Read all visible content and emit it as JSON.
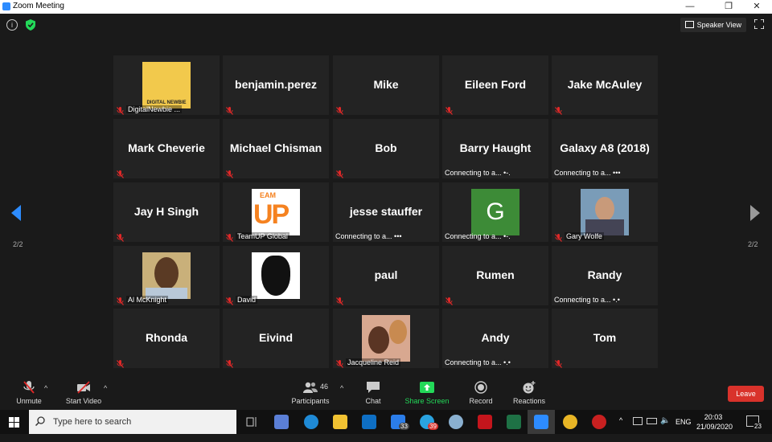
{
  "window": {
    "title": "Zoom Meeting",
    "minimize": "—",
    "restore": "❐",
    "close": "✕"
  },
  "top": {
    "speaker_view": "Speaker View"
  },
  "tiles": [
    {
      "name": "",
      "label": "DigitalNewbie ..."
    },
    {
      "name": "benjamin.perez",
      "label": ""
    },
    {
      "name": "Mike",
      "label": ""
    },
    {
      "name": "Eileen Ford",
      "label": ""
    },
    {
      "name": "Jake McAuley",
      "label": ""
    },
    {
      "name": "Mark Cheverie",
      "label": ""
    },
    {
      "name": "Michael Chisman",
      "label": ""
    },
    {
      "name": "Bob",
      "label": ""
    },
    {
      "name": "Barry Haught",
      "conn": "Connecting to a... •-."
    },
    {
      "name": "Galaxy A8 (2018)",
      "conn": "Connecting to a... •••"
    },
    {
      "name": "Jay H Singh",
      "label": ""
    },
    {
      "name": "",
      "label": "TeamUP Global"
    },
    {
      "name": "jesse stauffer",
      "conn": "Connecting to a... •••"
    },
    {
      "name": "",
      "conn": "Connecting to a... •-."
    },
    {
      "name": "",
      "label": "Gary Wolfe"
    },
    {
      "name": "",
      "label": "Al McKnight"
    },
    {
      "name": "",
      "label": "David"
    },
    {
      "name": "paul",
      "label": ""
    },
    {
      "name": "Rumen",
      "label": ""
    },
    {
      "name": "Randy",
      "conn": "Connecting to a... •.•"
    },
    {
      "name": "Rhonda",
      "label": ""
    },
    {
      "name": "Eivind",
      "label": ""
    },
    {
      "name": "",
      "label": "Jacqueline Reid"
    },
    {
      "name": "Andy",
      "conn": "Connecting to a... •.•"
    },
    {
      "name": "Tom",
      "label": ""
    }
  ],
  "pics": {
    "g_letter": "G",
    "teamup_top": "EAM",
    "teamup_big": "UP",
    "newbie_text": "DIGITAL NEWBIE"
  },
  "paging": {
    "left": "2/2",
    "right": "2/2"
  },
  "toolbar": {
    "unmute": "Unmute",
    "start_video": "Start Video",
    "participants": "Participants",
    "participants_count": "46",
    "chat": "Chat",
    "share_screen": "Share Screen",
    "record": "Record",
    "reactions": "Reactions",
    "leave": "Leave"
  },
  "taskbar": {
    "search_placeholder": "Type here to search",
    "badge_mail": "33",
    "badge_telegram": "39",
    "language": "ENG",
    "time": "20:03",
    "date": "21/09/2020",
    "notifications": "23"
  },
  "colors": {
    "accent": "#2d8cff",
    "share_green": "#23d959",
    "leave_red": "#d9322b",
    "tile_bg": "#232323",
    "mic_muted": "#e02828"
  }
}
